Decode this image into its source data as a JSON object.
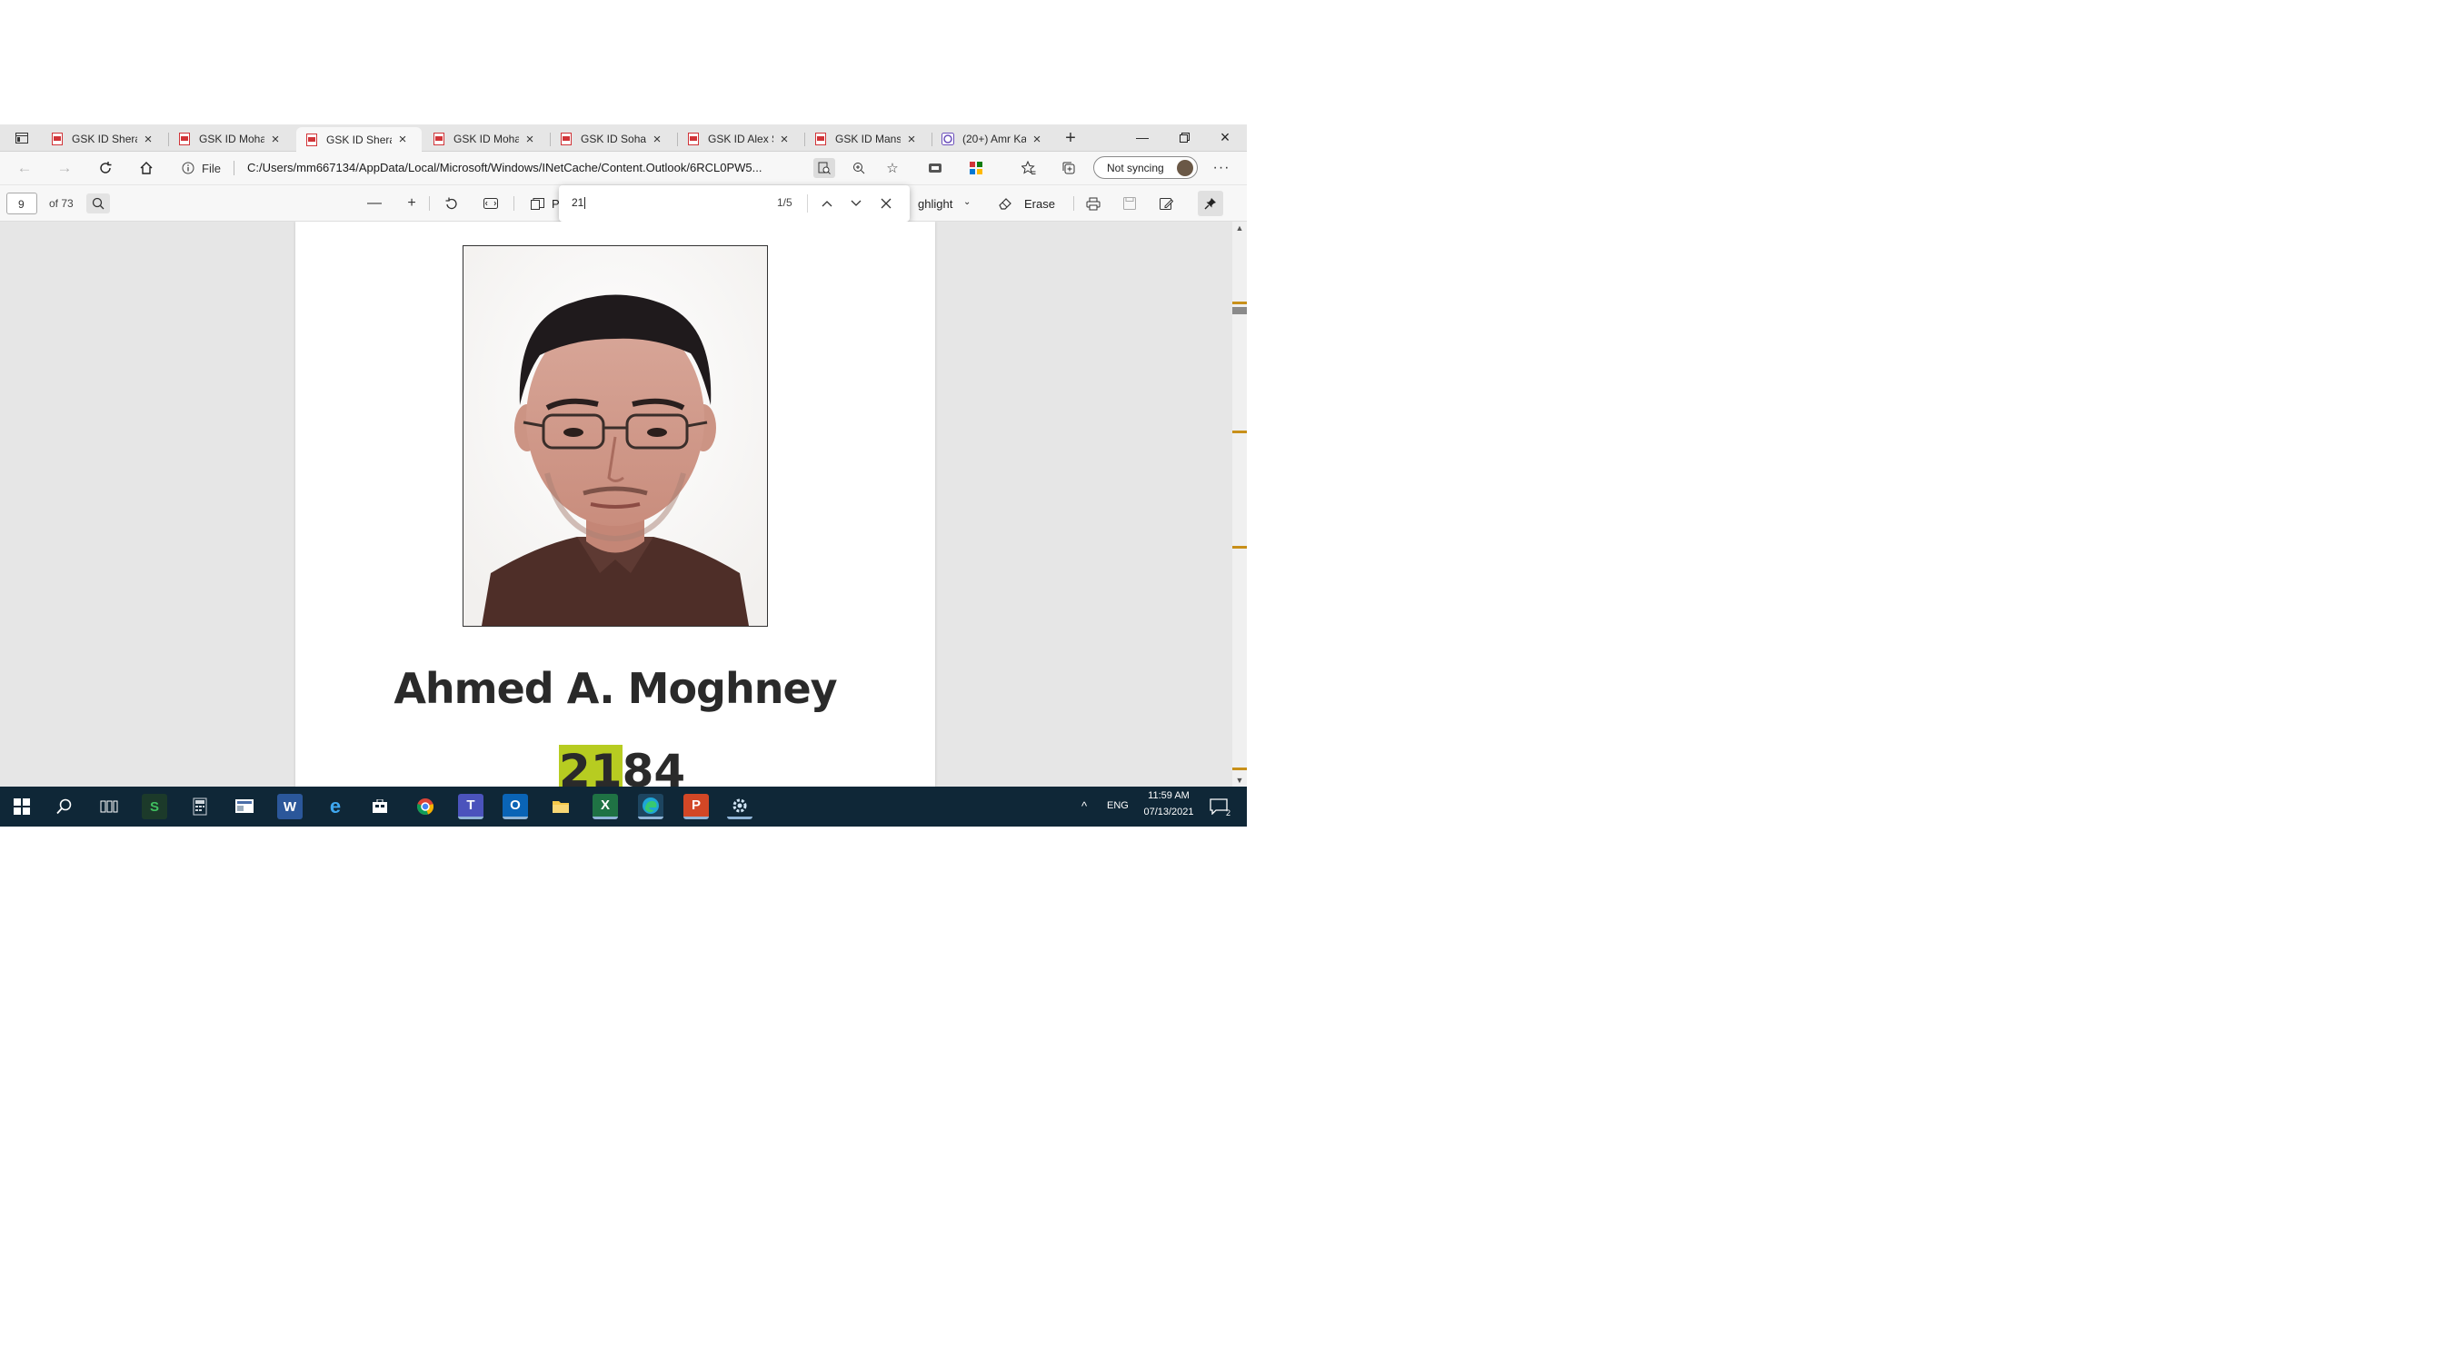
{
  "browser": {
    "tabs": [
      {
        "title": "GSK ID Sheraton",
        "active": false
      },
      {
        "title": "GSK ID Mohandessin",
        "active": false
      },
      {
        "title": "GSK ID Sheraton",
        "active": true
      },
      {
        "title": "GSK ID Mohandessin",
        "active": false
      },
      {
        "title": "GSK ID Sohag",
        "active": false
      },
      {
        "title": "GSK ID Alex S",
        "active": false
      },
      {
        "title": "GSK ID Mansoura",
        "active": false
      },
      {
        "title": "(20+) Amr Ka",
        "active": false
      }
    ],
    "address": {
      "scheme_label": "File",
      "url": "C:/Users/mm667134/AppData/Local/Microsoft/Windows/INetCache/Content.Outlook/6RCL0PW5..."
    },
    "sync_label": "Not syncing"
  },
  "pdf_toolbar": {
    "page_number": "9",
    "page_total": "of 73",
    "page_view_label": "P",
    "highlight_label": "ghlight",
    "erase_label": "Erase"
  },
  "find": {
    "query": "21",
    "count": "1/5"
  },
  "document": {
    "name": "Ahmed A. Moghney",
    "id_highlight": "21",
    "id_rest": "84"
  },
  "taskbar": {
    "lang": "ENG",
    "time": "11:59 AM",
    "date": "07/13/2021",
    "notification_count": "2"
  },
  "colors": {
    "find_highlight": "#b7cc21",
    "scroll_marker": "#c8901a",
    "taskbar": "#0f2737"
  }
}
